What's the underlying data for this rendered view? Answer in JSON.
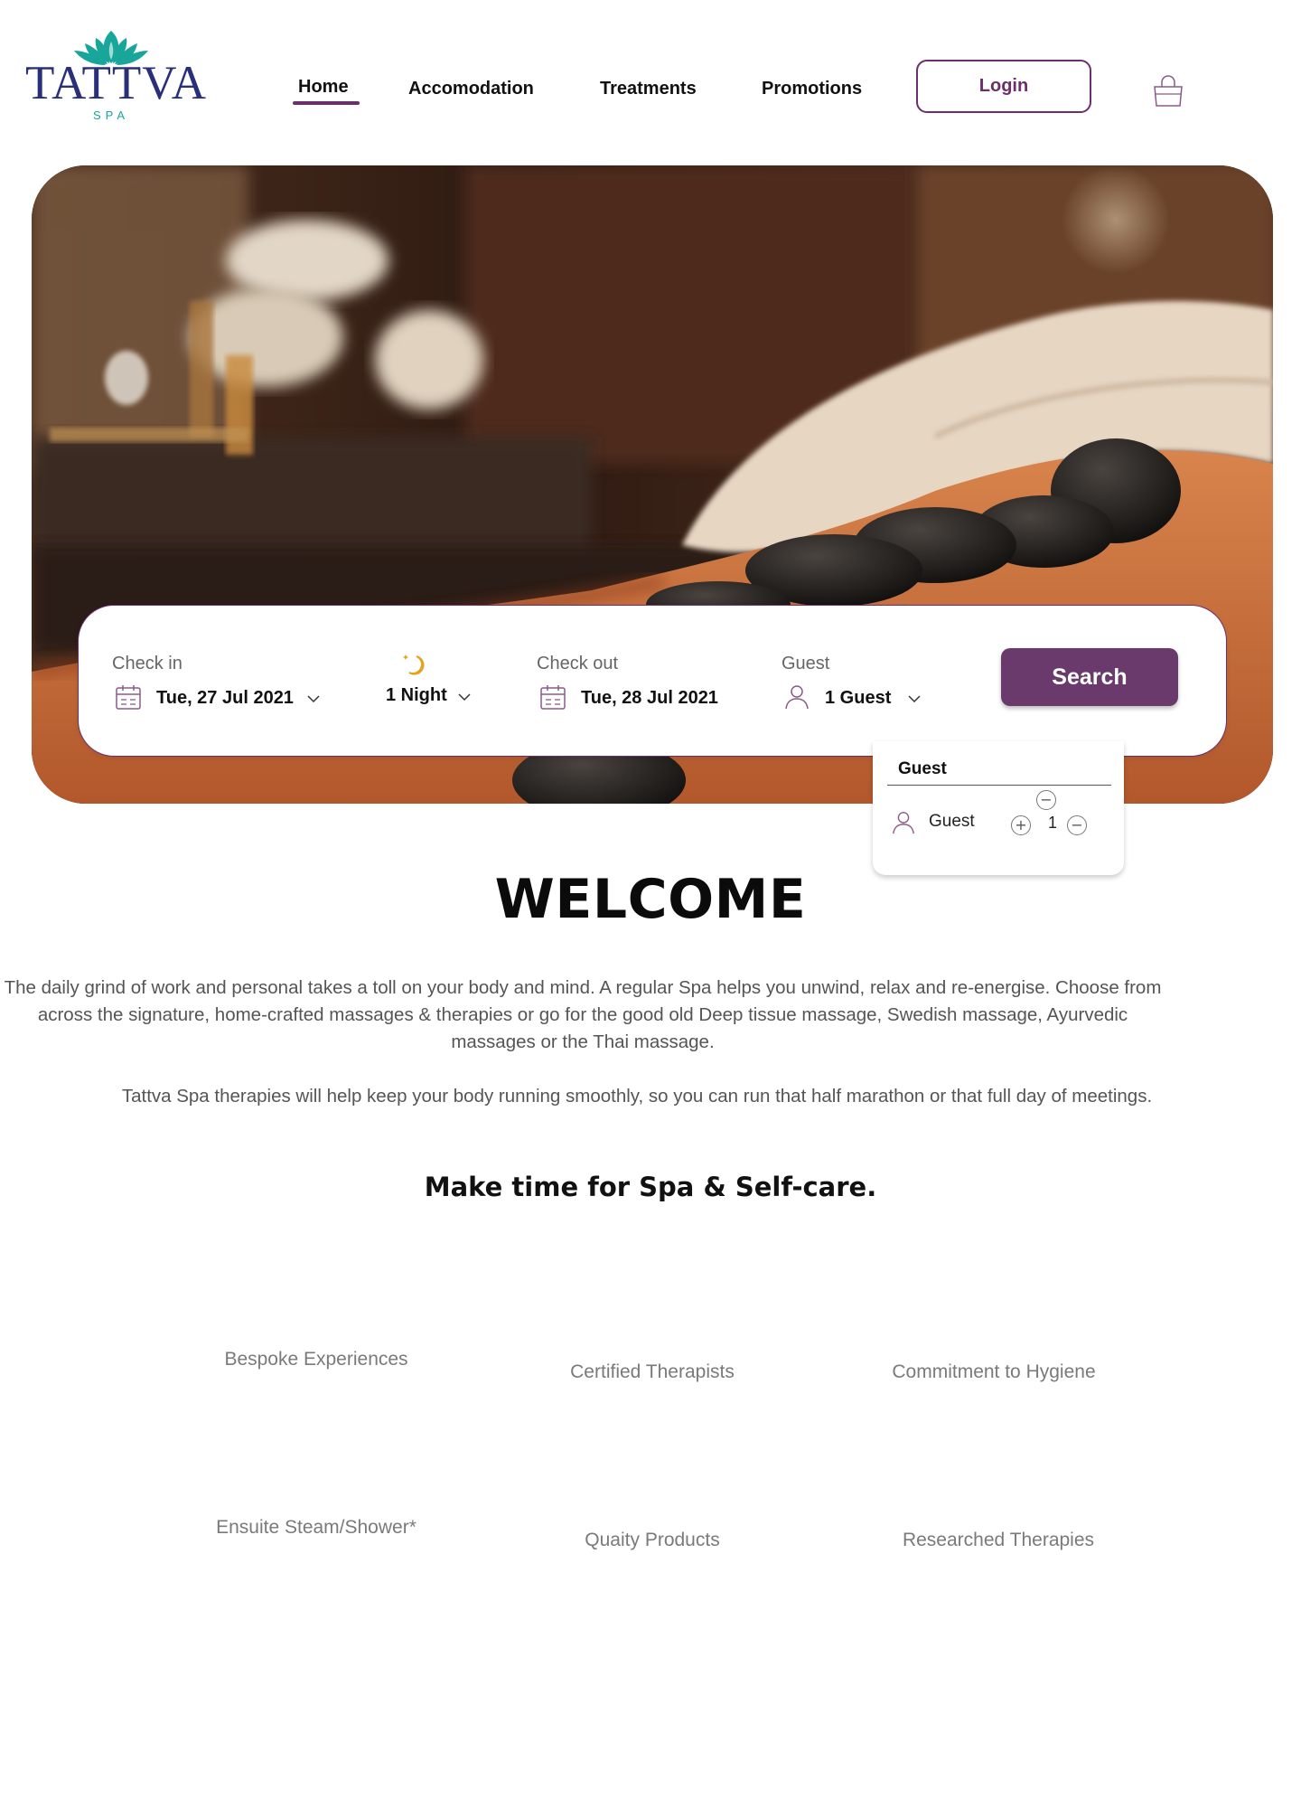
{
  "brand": {
    "name": "TATTVA",
    "sub": "SPA",
    "primary_color": "#6b2f6a",
    "logo_teal": "#18a69a",
    "logo_navy": "#2a2f7a"
  },
  "nav": {
    "items": [
      {
        "label": "Home",
        "active": true
      },
      {
        "label": "Accomodation"
      },
      {
        "label": "Treatments"
      },
      {
        "label": "Promotions"
      }
    ],
    "login_label": "Login",
    "cart_icon": "shopping-bag-icon"
  },
  "hero": {
    "image": "hot-stone-massage-photo"
  },
  "booking": {
    "check_in": {
      "label": "Check in",
      "value": "Tue, 27 Jul 2021"
    },
    "nights": {
      "value": "1 Night"
    },
    "check_out": {
      "label": "Check out",
      "value": "Tue, 28 Jul 2021"
    },
    "guest": {
      "label": "Guest",
      "value": "1 Guest"
    },
    "search_label": "Search"
  },
  "guest_popup": {
    "title": "Guest",
    "row_label": "Guest",
    "count": "1",
    "plus": "+",
    "minus": "−"
  },
  "welcome": {
    "title": "WELCOME",
    "para1": "The daily grind of work and personal takes a toll on your body and mind. A regular Spa helps you unwind, relax and re-energise. Choose from across the signature, home-crafted massages & therapies or go for the good old Deep tissue massage, Swedish massage, Ayurvedic massages or the Thai massage.",
    "para2": "Tattva Spa therapies will help keep your body running smoothly, so you can run that half marathon or that full day of meetings.",
    "tagline": "Make time for Spa & Self-care."
  },
  "features": [
    "Bespoke Experiences",
    "Certified Therapists",
    "Commitment to Hygiene",
    "Ensuite Steam/Shower*",
    "Quaity Products",
    "Researched Therapies"
  ]
}
